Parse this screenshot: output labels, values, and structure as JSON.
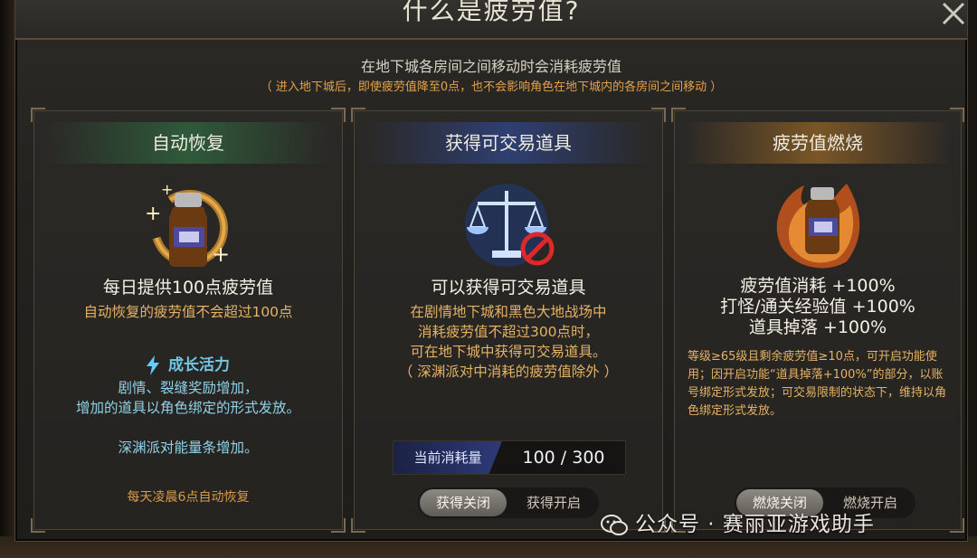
{
  "dialog": {
    "title": "什么是疲劳值?",
    "intro": "在地下城各房间之间移动时会消耗疲劳值",
    "intro_note": "（ 进入地下城后，即使疲劳值降至0点，也不会影响角色在地下城内的各房间之间移动 ）"
  },
  "panels": [
    {
      "header": "自动恢复",
      "icon": "fatigue-potion-recover-icon",
      "main": "每日提供100点疲劳值",
      "sub": "自动恢复的疲劳值不会超过100点",
      "growth_title": "成长活力",
      "growth_lines": [
        "剧情、裂缝奖励增加，",
        "增加的道具以角色绑定的形式发放。"
      ],
      "abyss_line": "深渊派对能量条增加。",
      "footer": "每天凌晨6点自动恢复"
    },
    {
      "header": "获得可交易道具",
      "icon": "scale-prohibited-icon",
      "main": "可以获得可交易道具",
      "desc_lines": [
        "在剧情地下城和黑色大地战场中",
        "消耗疲劳值不超过300点时，",
        "可在地下城中获得可交易道具。",
        "（ 深渊派对中消耗的疲劳值除外 ）"
      ],
      "meter_label": "当前消耗量",
      "meter_value": "100 / 300",
      "meter_current": 100,
      "meter_max": 300,
      "toggle_off": "获得关闭",
      "toggle_on": "获得开启"
    },
    {
      "header": "疲劳值燃烧",
      "icon": "burning-potion-icon",
      "main_lines": [
        "疲劳值消耗 +100%",
        "打怪/通关经验值 +100%",
        "道具掉落 +100%"
      ],
      "desc": "等级≥65级且剩余疲劳值≥10点，可开启功能使用；因开启功能“道具掉落+100%”的部分，以账号绑定形式发放；可交易限制的状态下，维持以角色绑定形式发放。",
      "toggle_off": "燃烧关闭",
      "toggle_on": "燃烧开启"
    }
  ],
  "watermark": "公众号 · 赛丽亚游戏助手",
  "colors": {
    "accent_orange": "#e6b264",
    "accent_cyan": "#6fc6e6",
    "title": "#e9e3d6"
  }
}
